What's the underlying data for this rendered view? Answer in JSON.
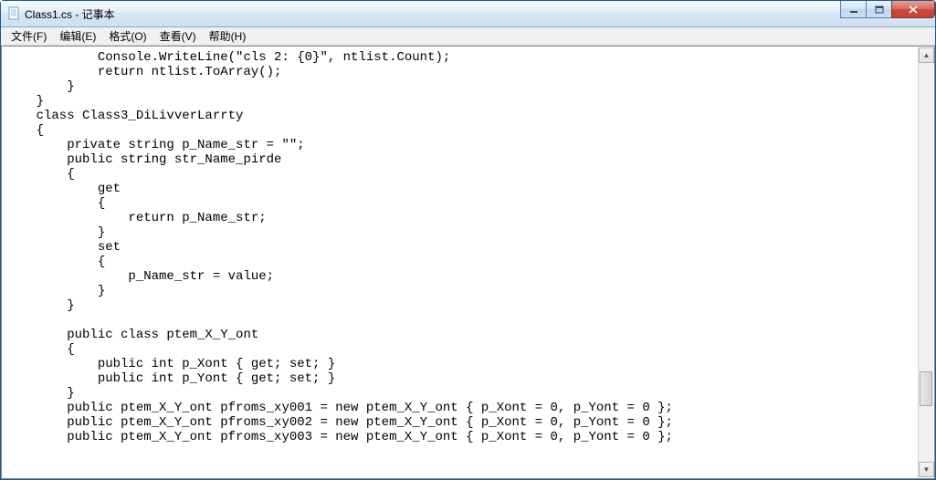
{
  "window": {
    "title": "Class1.cs - 记事本"
  },
  "menu": {
    "file": "文件(F)",
    "edit": "编辑(E)",
    "format": "格式(O)",
    "view": "查看(V)",
    "help": "帮助(H)"
  },
  "code": "            Console.WriteLine(\"cls 2: {0}\", ntlist.Count);\n            return ntlist.ToArray();\n        }\n    }\n    class Class3_DiLivverLarrty\n    {\n        private string p_Name_str = \"\";\n        public string str_Name_pirde\n        {\n            get\n            {\n                return p_Name_str;\n            }\n            set\n            {\n                p_Name_str = value;\n            }\n        }\n\n        public class ptem_X_Y_ont\n        {\n            public int p_Xont { get; set; }\n            public int p_Yont { get; set; }\n        }\n        public ptem_X_Y_ont pfroms_xy001 = new ptem_X_Y_ont { p_Xont = 0, p_Yont = 0 };\n        public ptem_X_Y_ont pfroms_xy002 = new ptem_X_Y_ont { p_Xont = 0, p_Yont = 0 };\n        public ptem_X_Y_ont pfroms_xy003 = new ptem_X_Y_ont { p_Xont = 0, p_Yont = 0 };"
}
